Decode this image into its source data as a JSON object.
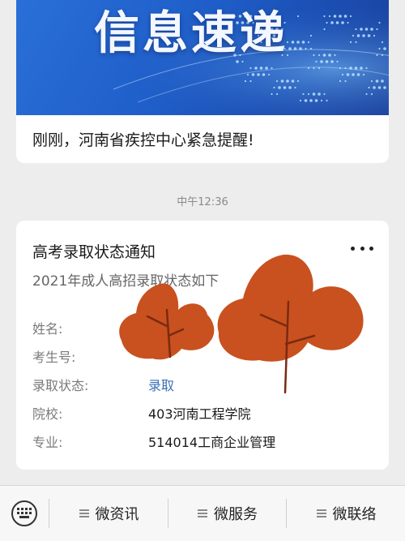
{
  "news": {
    "banner_title": "信息速递",
    "headline": "刚刚，河南省疾控中心紧急提醒!"
  },
  "chat": {
    "timestamp": "中午12:36"
  },
  "notice": {
    "title": "高考录取状态通知",
    "subtitle": "2021年成人高招录取状态如下",
    "more_icon": "more-dots-icon",
    "fields": [
      {
        "label": "姓名:",
        "value": ""
      },
      {
        "label": "考生号:",
        "value": ""
      },
      {
        "label": "录取状态:",
        "value": "录取"
      },
      {
        "label": "院校:",
        "value": "403河南工程学院"
      },
      {
        "label": "专业:",
        "value": "514014工商企业管理"
      }
    ],
    "accent_color": "#3a6fb4",
    "redaction_color": "#c9511f"
  },
  "menu": {
    "keyboard_icon": "keyboard-icon",
    "items": [
      {
        "label": "微资讯",
        "icon": "hamburger-icon"
      },
      {
        "label": "微服务",
        "icon": "hamburger-icon"
      },
      {
        "label": "微联络",
        "icon": "hamburger-icon"
      }
    ]
  }
}
